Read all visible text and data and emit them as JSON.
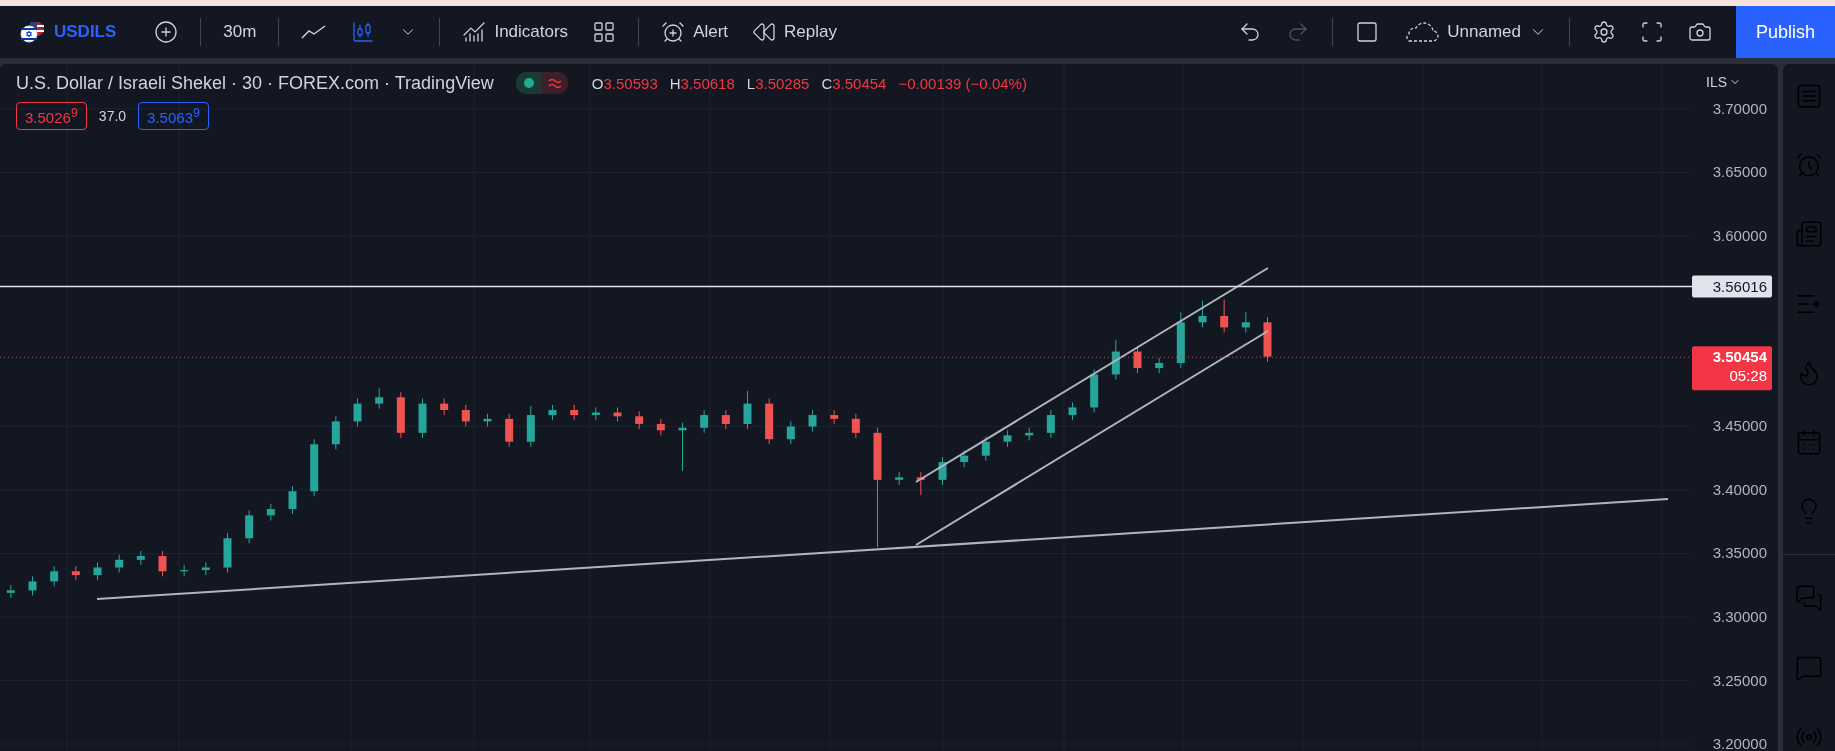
{
  "toolbar": {
    "symbol": "USDILS",
    "interval": "30m",
    "indicators_label": "Indicators",
    "alert_label": "Alert",
    "replay_label": "Replay",
    "layout_name": "Unnamed",
    "publish_label": "Publish"
  },
  "legend": {
    "title": "U.S. Dollar / Israeli Shekel · 30 · FOREX.com · TradingView",
    "ohlc": [
      {
        "key": "O",
        "value": "3.50593"
      },
      {
        "key": "H",
        "value": "3.50618"
      },
      {
        "key": "L",
        "value": "3.50285"
      },
      {
        "key": "C",
        "value": "3.50454"
      }
    ],
    "change": "−0.00139 (−0.04%)",
    "bid": "3.5026$^{9}$",
    "spread": "37.0",
    "ask": "3.5063$^{9}$"
  },
  "price_axis": {
    "currency": "ILS",
    "price_lines": [
      {
        "label": "3.56016",
        "color": "#e0e3eb"
      },
      {
        "label": "3.50454",
        "color": "#f23645",
        "countdown": "05:28"
      }
    ]
  },
  "chart_data": {
    "type": "candlestick",
    "grid": true,
    "ylim": [
      3.1945,
      3.7354
    ],
    "yticks": [
      {
        "value": 3.7,
        "label": "3.70000"
      },
      {
        "value": 3.65,
        "label": "3.65000"
      },
      {
        "value": 3.6,
        "label": "3.60000"
      },
      {
        "value": 3.45,
        "label": "3.45000"
      },
      {
        "value": 3.4,
        "label": "3.40000"
      },
      {
        "value": 3.35,
        "label": "3.35000"
      },
      {
        "value": 3.3,
        "label": "3.30000"
      },
      {
        "value": 3.25,
        "label": "3.25000"
      },
      {
        "value": 3.2,
        "label": "3.20000"
      }
    ],
    "ohlc": [
      [
        3.319,
        3.325,
        3.315,
        3.321
      ],
      [
        3.321,
        3.332,
        3.317,
        3.328
      ],
      [
        3.328,
        3.34,
        3.324,
        3.336
      ],
      [
        3.336,
        3.34,
        3.329,
        3.333
      ],
      [
        3.333,
        3.343,
        3.329,
        3.339
      ],
      [
        3.339,
        3.349,
        3.335,
        3.345
      ],
      [
        3.345,
        3.352,
        3.341,
        3.348
      ],
      [
        3.348,
        3.352,
        3.332,
        3.336
      ],
      [
        3.336,
        3.341,
        3.332,
        3.337
      ],
      [
        3.337,
        3.343,
        3.333,
        3.339
      ],
      [
        3.339,
        3.366,
        3.335,
        3.362
      ],
      [
        3.362,
        3.384,
        3.358,
        3.38
      ],
      [
        3.38,
        3.389,
        3.376,
        3.385
      ],
      [
        3.385,
        3.403,
        3.381,
        3.399
      ],
      [
        3.399,
        3.44,
        3.395,
        3.436
      ],
      [
        3.436,
        3.458,
        3.432,
        3.454
      ],
      [
        3.454,
        3.472,
        3.45,
        3.468
      ],
      [
        3.468,
        3.48,
        3.464,
        3.473
      ],
      [
        3.473,
        3.477,
        3.441,
        3.445
      ],
      [
        3.445,
        3.472,
        3.441,
        3.468
      ],
      [
        3.468,
        3.472,
        3.459,
        3.463
      ],
      [
        3.463,
        3.467,
        3.45,
        3.454
      ],
      [
        3.454,
        3.46,
        3.45,
        3.456
      ],
      [
        3.456,
        3.46,
        3.434,
        3.438
      ],
      [
        3.438,
        3.466,
        3.434,
        3.459
      ],
      [
        3.459,
        3.467,
        3.455,
        3.463
      ],
      [
        3.463,
        3.467,
        3.455,
        3.459
      ],
      [
        3.459,
        3.465,
        3.455,
        3.461
      ],
      [
        3.461,
        3.465,
        3.454,
        3.458
      ],
      [
        3.458,
        3.462,
        3.448,
        3.452
      ],
      [
        3.452,
        3.456,
        3.443,
        3.447
      ],
      [
        3.447,
        3.453,
        3.415,
        3.449
      ],
      [
        3.449,
        3.463,
        3.445,
        3.459
      ],
      [
        3.459,
        3.463,
        3.448,
        3.452
      ],
      [
        3.452,
        3.478,
        3.448,
        3.468
      ],
      [
        3.468,
        3.472,
        3.436,
        3.44
      ],
      [
        3.44,
        3.454,
        3.436,
        3.45
      ],
      [
        3.45,
        3.463,
        3.446,
        3.459
      ],
      [
        3.459,
        3.463,
        3.452,
        3.456
      ],
      [
        3.456,
        3.46,
        3.441,
        3.445
      ],
      [
        3.445,
        3.449,
        3.355,
        3.408
      ],
      [
        3.408,
        3.414,
        3.404,
        3.41
      ],
      [
        3.41,
        3.414,
        3.396,
        3.408
      ],
      [
        3.408,
        3.426,
        3.404,
        3.422
      ],
      [
        3.422,
        3.431,
        3.418,
        3.427
      ],
      [
        3.427,
        3.442,
        3.423,
        3.438
      ],
      [
        3.438,
        3.447,
        3.434,
        3.443
      ],
      [
        3.443,
        3.449,
        3.439,
        3.445
      ],
      [
        3.445,
        3.463,
        3.441,
        3.459
      ],
      [
        3.459,
        3.469,
        3.455,
        3.465
      ],
      [
        3.465,
        3.495,
        3.461,
        3.491
      ],
      [
        3.491,
        3.518,
        3.487,
        3.509
      ],
      [
        3.509,
        3.513,
        3.492,
        3.496
      ],
      [
        3.496,
        3.504,
        3.492,
        3.5
      ],
      [
        3.5,
        3.54,
        3.496,
        3.532
      ],
      [
        3.532,
        3.549,
        3.528,
        3.537
      ],
      [
        3.537,
        3.55,
        3.524,
        3.528
      ],
      [
        3.528,
        3.54,
        3.524,
        3.532
      ],
      [
        3.532,
        3.536,
        3.501,
        3.505
      ],
      null,
      null,
      null,
      null,
      null,
      null,
      null,
      null,
      null,
      null,
      null,
      null,
      null,
      null,
      null,
      null,
      null,
      null,
      null
    ]
  }
}
